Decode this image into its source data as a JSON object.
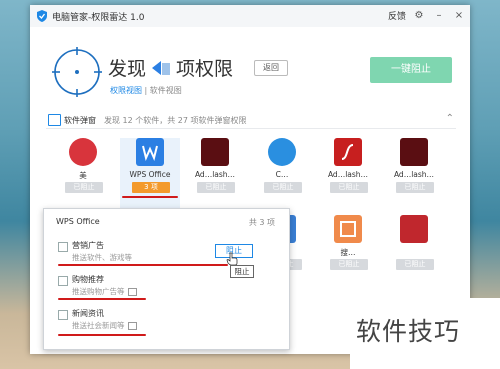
{
  "window": {
    "title": "电脑管家-权限雷达 1.0",
    "feedback_label": "反馈",
    "settings_icon": "gear-icon",
    "minimize_label": "–",
    "close_label": "×"
  },
  "header": {
    "title_left": "发现",
    "title_right": "项权限",
    "back_label": "返回",
    "view_active": "权限视图",
    "view_separator": "|",
    "view_other": "软件视图",
    "oneclick_label": "一键阻止"
  },
  "category": {
    "name": "软件弹窗",
    "description": "发现 12 个软件，共 27 项软件弹窗权限"
  },
  "apps_row1": [
    {
      "name": "美",
      "button": "已阻止",
      "icon_color": "#d8343c"
    },
    {
      "name": "WPS Office",
      "button": "3 项",
      "icon_color": "#2b7fe3",
      "active": true
    },
    {
      "name": "Ad…lash…",
      "button": "已阻止",
      "icon_color": "#5a0e12"
    },
    {
      "name": "C…",
      "button": "已阻止",
      "icon_color": "#2a8fe0"
    },
    {
      "name": "Ad…lash…",
      "button": "已阻止",
      "icon_color": "#c71f1f"
    },
    {
      "name": "Ad…lash…",
      "button": "已阻止",
      "icon_color": "#5a0e12"
    }
  ],
  "apps_row2": [
    {
      "name": "",
      "button": "已阻止",
      "icon_color": "#3a7fd4"
    },
    {
      "name": "搜…",
      "button": "已阻止",
      "icon_color": "#f08a4b"
    },
    {
      "name": "",
      "button": "已阻止",
      "icon_color": "#c0272d"
    }
  ],
  "popup": {
    "title": "WPS Office",
    "count": "共 3 项",
    "items": [
      {
        "label": "营销广告",
        "sub": "推送软件、游戏等"
      },
      {
        "label": "购物推荐",
        "sub": "推送购物广告等"
      },
      {
        "label": "新闻资讯",
        "sub": "推送社会新闻等"
      }
    ],
    "block_label": "阻止",
    "tooltip": "阻止"
  },
  "watermark": "软件技巧"
}
